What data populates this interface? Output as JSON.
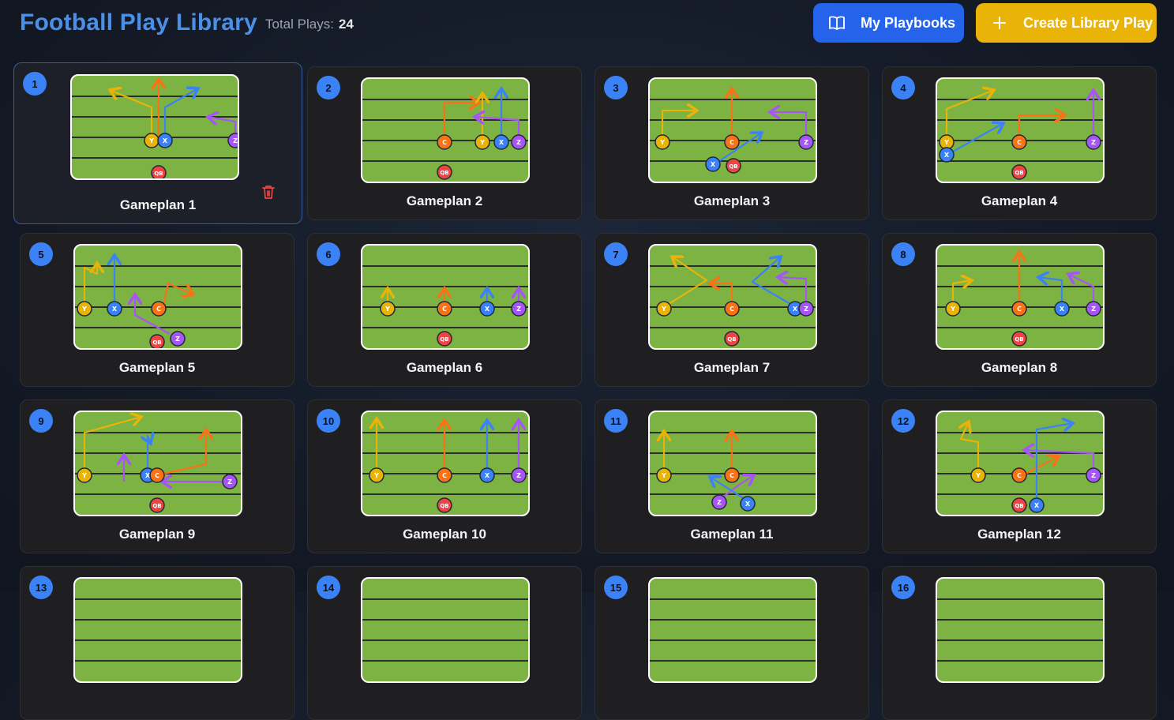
{
  "header": {
    "title": "Football Play Library",
    "total_label": "Total Plays:",
    "total_value": "24",
    "playbooks_label": "My Playbooks",
    "create_label": "Create Library Play"
  },
  "colors": {
    "accent_blue": "#3b82f6",
    "create_yellow": "#eab308",
    "Y": "#eab308",
    "X": "#3b82f6",
    "Z": "#a855f7",
    "C": "#f97316",
    "QB": "#ef4444",
    "field": "#7cb342"
  },
  "plays": [
    {
      "num": "1",
      "name": "Gameplan 1",
      "players": [
        "Y",
        "X",
        "Z",
        "QB"
      ]
    },
    {
      "num": "2",
      "name": "Gameplan 2",
      "players": [
        "C",
        "Y",
        "X",
        "Z",
        "QB"
      ]
    },
    {
      "num": "3",
      "name": "Gameplan 3",
      "players": [
        "Y",
        "C",
        "Z",
        "X",
        "QB"
      ]
    },
    {
      "num": "4",
      "name": "Gameplan 4",
      "players": [
        "Y",
        "X",
        "C",
        "Z",
        "QB"
      ]
    },
    {
      "num": "5",
      "name": "Gameplan 5",
      "players": [
        "Y",
        "X",
        "C",
        "QB",
        "Z"
      ]
    },
    {
      "num": "6",
      "name": "Gameplan 6",
      "players": [
        "Y",
        "C",
        "X",
        "Z",
        "QB"
      ]
    },
    {
      "num": "7",
      "name": "Gameplan 7",
      "players": [
        "Y",
        "C",
        "X",
        "Z",
        "QB"
      ]
    },
    {
      "num": "8",
      "name": "Gameplan 8",
      "players": [
        "Y",
        "C",
        "X",
        "Z",
        "QB"
      ]
    },
    {
      "num": "9",
      "name": "Gameplan 9",
      "players": [
        "Y",
        "X",
        "C",
        "Z",
        "QB"
      ]
    },
    {
      "num": "10",
      "name": "Gameplan 10",
      "players": [
        "Y",
        "C",
        "X",
        "Z",
        "QB"
      ]
    },
    {
      "num": "11",
      "name": "Gameplan 11",
      "players": [
        "Y",
        "C",
        "Z",
        "X"
      ]
    },
    {
      "num": "12",
      "name": "Gameplan 12",
      "players": [
        "Y",
        "C",
        "Z",
        "QB",
        "X"
      ]
    },
    {
      "num": "13",
      "name": "",
      "players": []
    },
    {
      "num": "14",
      "name": "",
      "players": []
    },
    {
      "num": "15",
      "name": "",
      "players": []
    },
    {
      "num": "16",
      "name": "",
      "players": []
    }
  ]
}
